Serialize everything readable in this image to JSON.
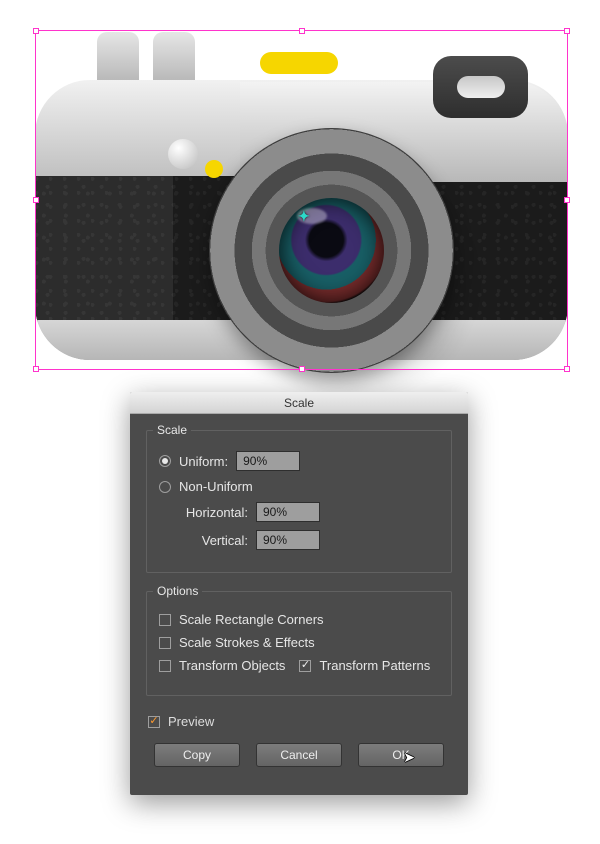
{
  "canvas": {
    "selection_color": "#ff33cc",
    "center_glyph": "✦"
  },
  "dialog": {
    "title": "Scale",
    "scale_group_label": "Scale",
    "uniform_label": "Uniform:",
    "uniform_value": "90%",
    "nonuniform_label": "Non-Uniform",
    "horizontal_label": "Horizontal:",
    "horizontal_value": "90%",
    "vertical_label": "Vertical:",
    "vertical_value": "90%",
    "scale_mode": "uniform",
    "options_group_label": "Options",
    "scale_corners_label": "Scale Rectangle Corners",
    "scale_corners_checked": false,
    "scale_strokes_label": "Scale Strokes & Effects",
    "scale_strokes_checked": false,
    "transform_objects_label": "Transform Objects",
    "transform_objects_checked": false,
    "transform_patterns_label": "Transform Patterns",
    "transform_patterns_checked": true,
    "preview_label": "Preview",
    "preview_checked": true,
    "buttons": {
      "copy": "Copy",
      "cancel": "Cancel",
      "ok": "OK"
    }
  }
}
